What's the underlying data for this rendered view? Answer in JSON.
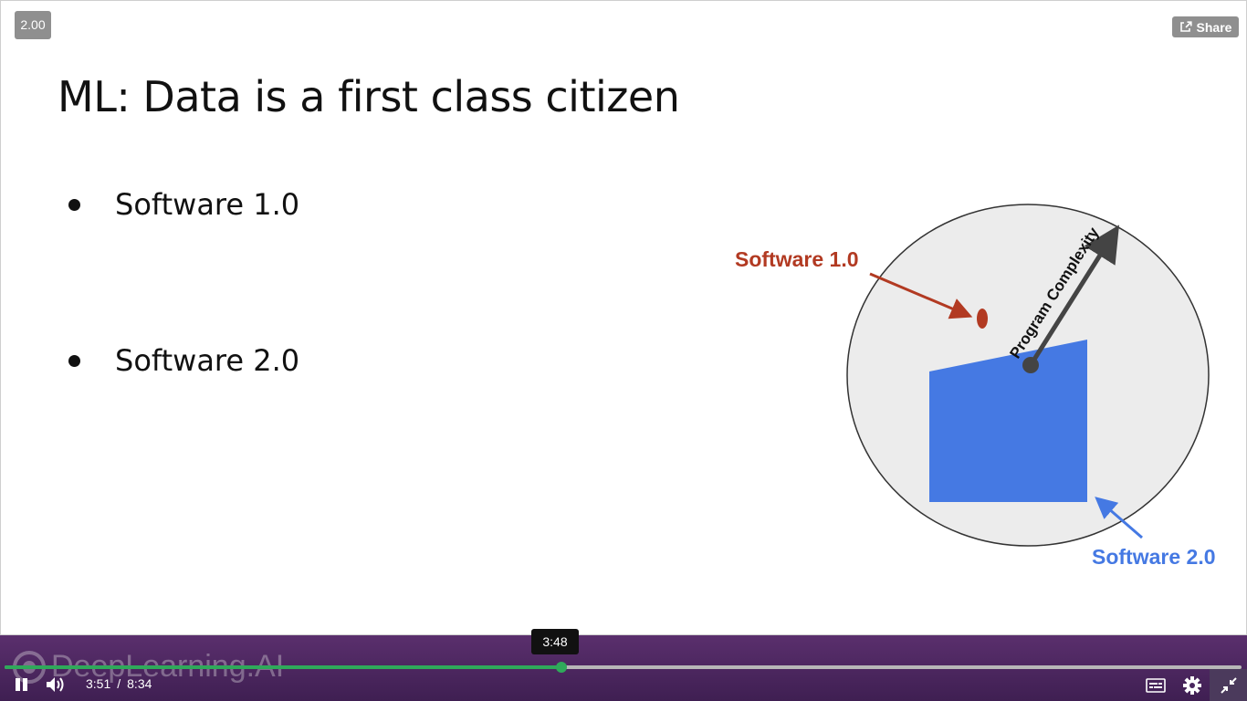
{
  "slide": {
    "title": "ML: Data is a first class citizen",
    "bullets": [
      "Software 1.0",
      "Software 2.0"
    ]
  },
  "diagram": {
    "label_software1": "Software 1.0",
    "label_software2": "Software 2.0",
    "arrow_label": "Program Complexity",
    "colors": {
      "software1": "#b23a22",
      "software2": "#4579e3",
      "circle_fill": "#ececec",
      "arrow": "#444444"
    }
  },
  "overlay": {
    "speed": "2.00",
    "share_label": "Share"
  },
  "player": {
    "watermark": "DeepLearning.AI",
    "current_time": "3:51",
    "separator": "/",
    "duration": "8:34",
    "hover_time": "3:48",
    "progress_fraction": 0.45,
    "accent_color": "#2fa95a",
    "icons": [
      "pause-icon",
      "volume-icon",
      "captions-icon",
      "settings-icon",
      "exit-fullscreen-icon"
    ]
  }
}
